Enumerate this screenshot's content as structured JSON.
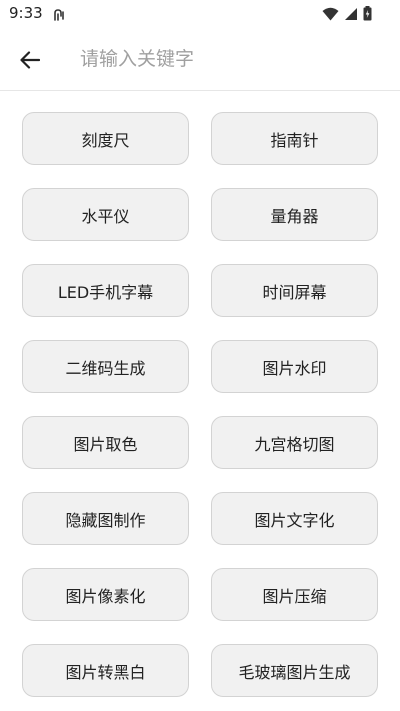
{
  "status_bar": {
    "time": "9:33",
    "icons": [
      "notification-icon",
      "wifi-icon",
      "signal-icon",
      "battery-icon"
    ]
  },
  "search": {
    "placeholder": "请输入关键字",
    "value": ""
  },
  "tools": [
    "刻度尺",
    "指南针",
    "水平仪",
    "量角器",
    "LED手机字幕",
    "时间屏幕",
    "二维码生成",
    "图片水印",
    "图片取色",
    "九宫格切图",
    "隐藏图制作",
    "图片文字化",
    "图片像素化",
    "图片压缩",
    "图片转黑白",
    "毛玻璃图片生成"
  ]
}
